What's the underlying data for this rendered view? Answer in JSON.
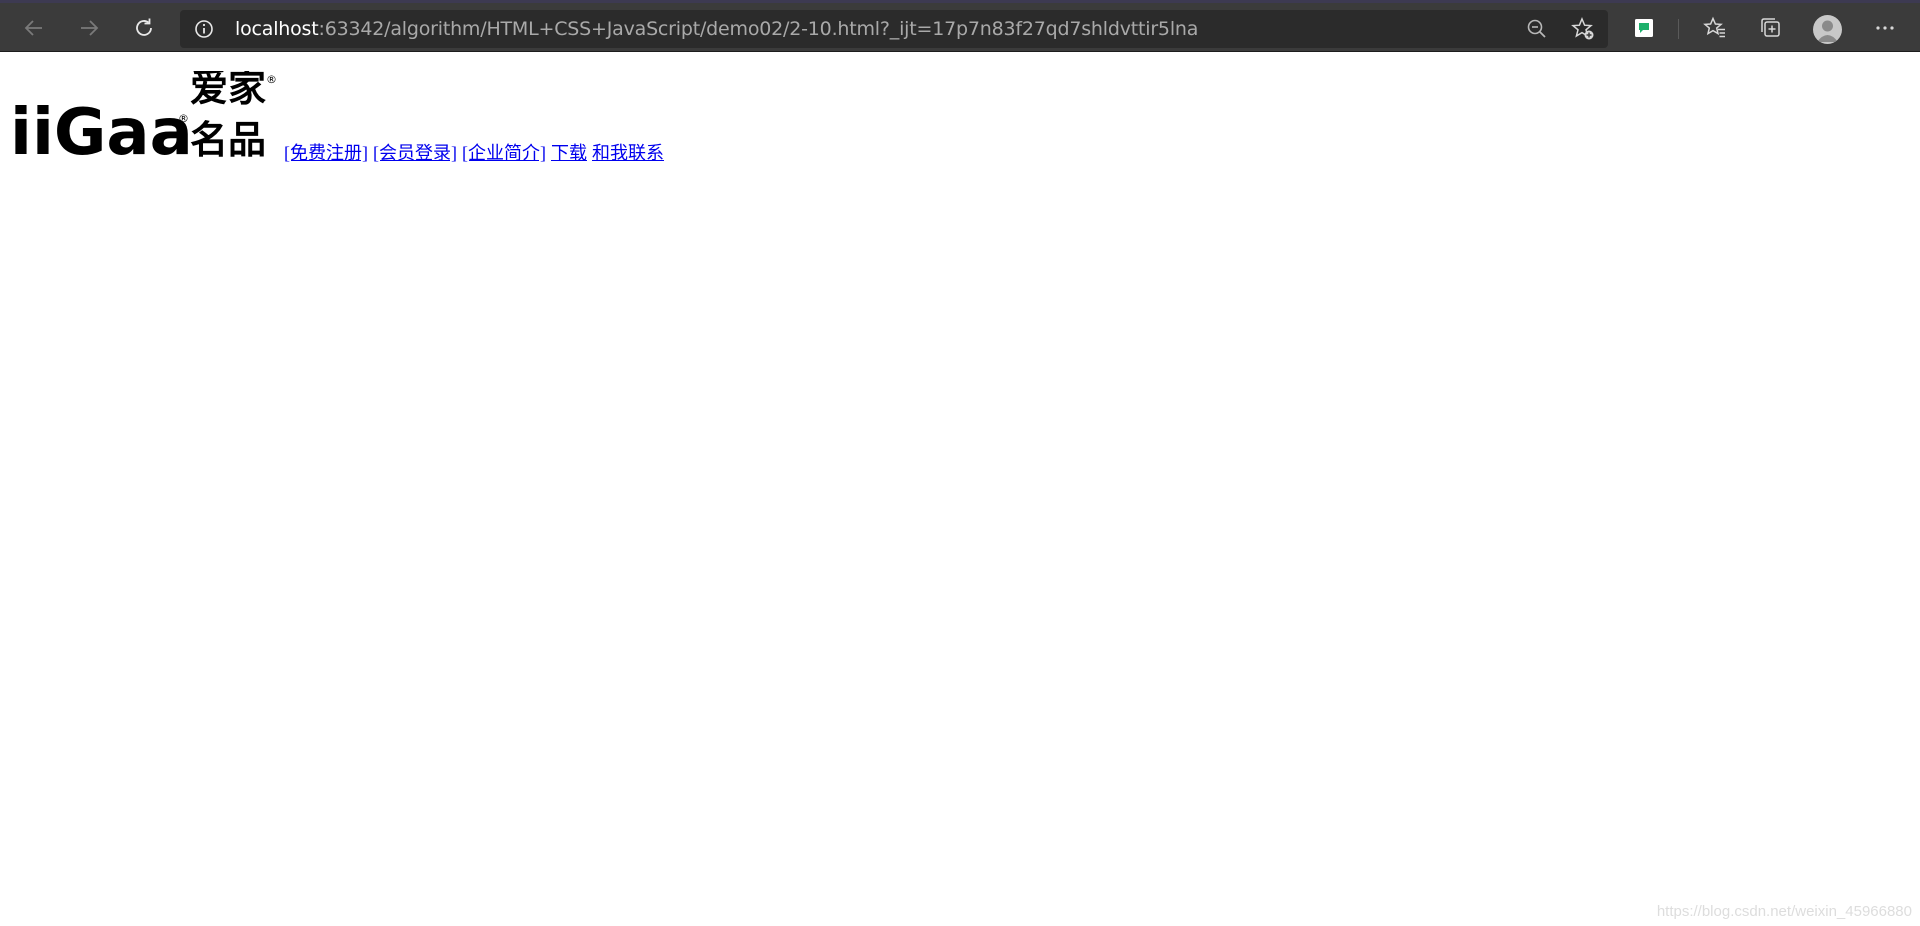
{
  "browser": {
    "url_host": "localhost",
    "url_rest": ":63342/algorithm/HTML+CSS+JavaScript/demo02/2-10.html?_ijt=17p7n83f27qd7shldvttir5lna",
    "icons": [
      "back-arrow-icon",
      "forward-arrow-icon",
      "refresh-icon",
      "info-icon",
      "zoom-out-icon",
      "add-favorite-icon",
      "extension-icon",
      "favorites-icon",
      "collections-icon",
      "profile-avatar",
      "more-icon"
    ]
  },
  "page": {
    "logo": {
      "latin_text": "iiGaa",
      "cn_line1": "爱家",
      "cn_line2": "名品",
      "registered_mark": "®"
    },
    "nav": [
      {
        "label": "[免费注册]"
      },
      {
        "label": "[会员登录]"
      },
      {
        "label": "[企业简介]"
      },
      {
        "label": "下载"
      },
      {
        "label": "和我联系"
      }
    ]
  },
  "watermark": "https://blog.csdn.net/weixin_45966880"
}
